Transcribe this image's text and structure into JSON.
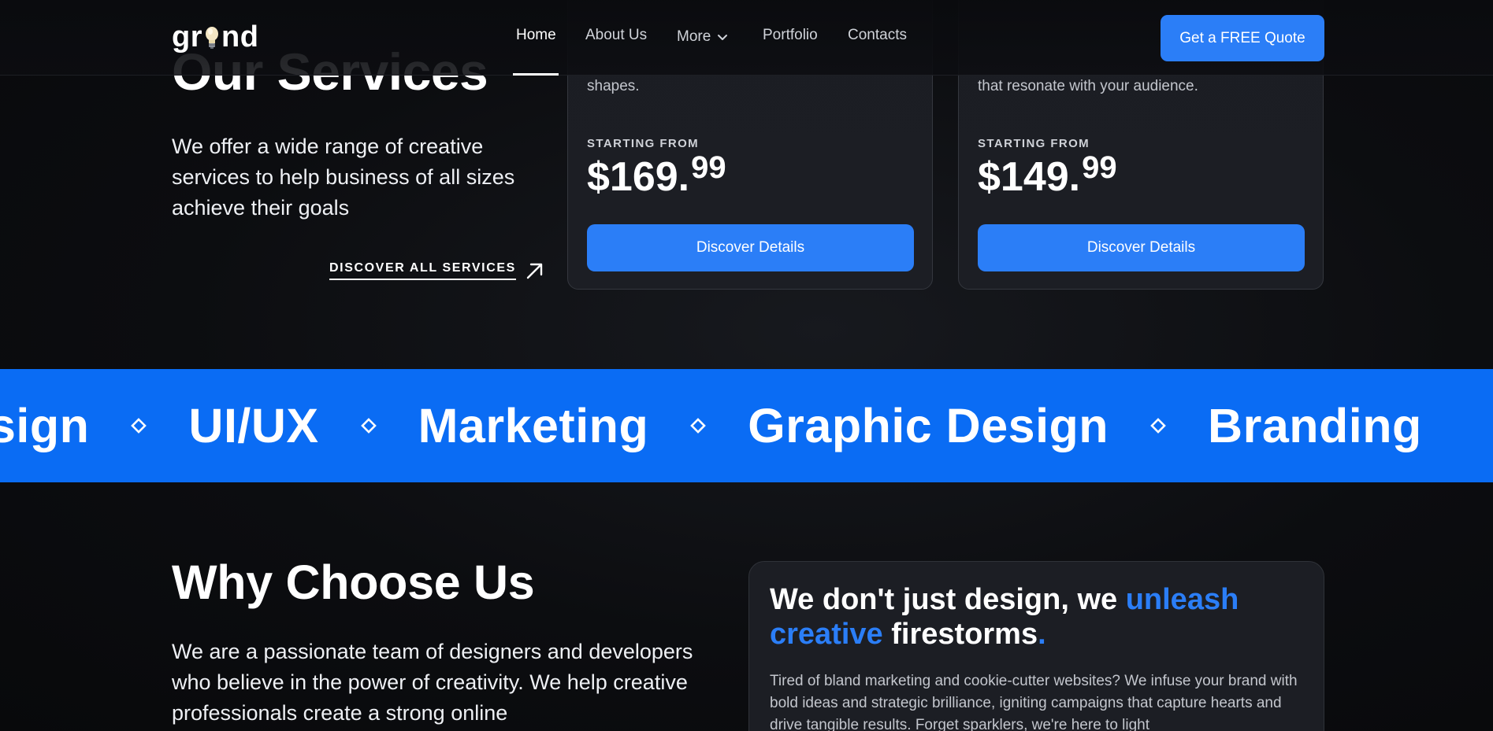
{
  "nav": {
    "logo_left": "gr",
    "logo_right": "nd",
    "links": {
      "home": "Home",
      "about": "About Us",
      "more": "More",
      "portfolio": "Portfolio",
      "contacts": "Contacts"
    },
    "cta": "Get a FREE Quote"
  },
  "services": {
    "heading": "Our Services",
    "description": "We offer a wide range of creative services to help business of all sizes achieve their goals",
    "discover_all": "DISCOVER ALL SERVICES",
    "cards": [
      {
        "desc_tail": "shapes.",
        "starting_label": "STARTING FROM",
        "price_main": "$169.",
        "price_cents": "99",
        "button": "Discover Details"
      },
      {
        "desc_tail": "that resonate with your audience.",
        "starting_label": "STARTING FROM",
        "price_main": "$149.",
        "price_cents": "99",
        "button": "Discover Details"
      }
    ]
  },
  "marquee": {
    "items": [
      "sign",
      "UI/UX",
      "Marketing",
      "Graphic Design",
      "Branding"
    ]
  },
  "why": {
    "heading": "Why Choose Us",
    "description": "We are a passionate team of designers and developers who believe in the power of creativity. We help creative professionals create a strong online",
    "card": {
      "title_part1": "We don't just design, we ",
      "title_accent": "unleash creative",
      "title_part2": " firestorms",
      "title_dot": ".",
      "body": "Tired of bland marketing and cookie-cutter websites? We infuse your brand with bold ideas and strategic brilliance, igniting campaigns that capture hearts and drive tangible results. Forget sparklers, we're here to light"
    }
  },
  "colors": {
    "accent": "#2b7ef7",
    "marquee_bg": "#0a6cf4",
    "background": "#0c0d10",
    "card_bg": "#1c1e24"
  },
  "icons": {
    "logo_bulb": "lightbulb-icon",
    "more_chevron": "chevron-down-icon",
    "discover_arrow": "arrow-up-right-icon",
    "marquee_separator": "diamond-icon"
  }
}
